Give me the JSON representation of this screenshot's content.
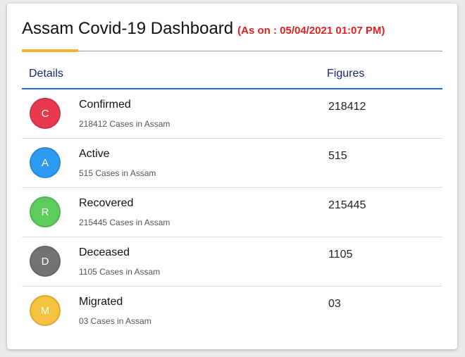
{
  "header": {
    "title": "Assam Covid-19 Dashboard",
    "as_on": "(As on : 05/04/2021 01:07 PM)"
  },
  "table": {
    "col_details": "Details",
    "col_figures": "Figures"
  },
  "rows": [
    {
      "initial": "C",
      "name": "Confirmed",
      "subtitle": "218412 Cases in Assam",
      "figure": "218412",
      "color": "#e8394f"
    },
    {
      "initial": "A",
      "name": "Active",
      "subtitle": "515 Cases in Assam",
      "figure": "515",
      "color": "#2f9bf0"
    },
    {
      "initial": "R",
      "name": "Recovered",
      "subtitle": "215445 Cases in Assam",
      "figure": "215445",
      "color": "#5ccc5c"
    },
    {
      "initial": "D",
      "name": "Deceased",
      "subtitle": "1105 Cases in Assam",
      "figure": "1105",
      "color": "#737373"
    },
    {
      "initial": "M",
      "name": "Migrated",
      "subtitle": "03 Cases in Assam",
      "figure": "03",
      "color": "#f6c33e"
    }
  ],
  "colors": {
    "accent": "#f2b134",
    "header_rule": "#1f6fd6",
    "as_on": "#e02020",
    "column_heading": "#1a2a6b"
  }
}
